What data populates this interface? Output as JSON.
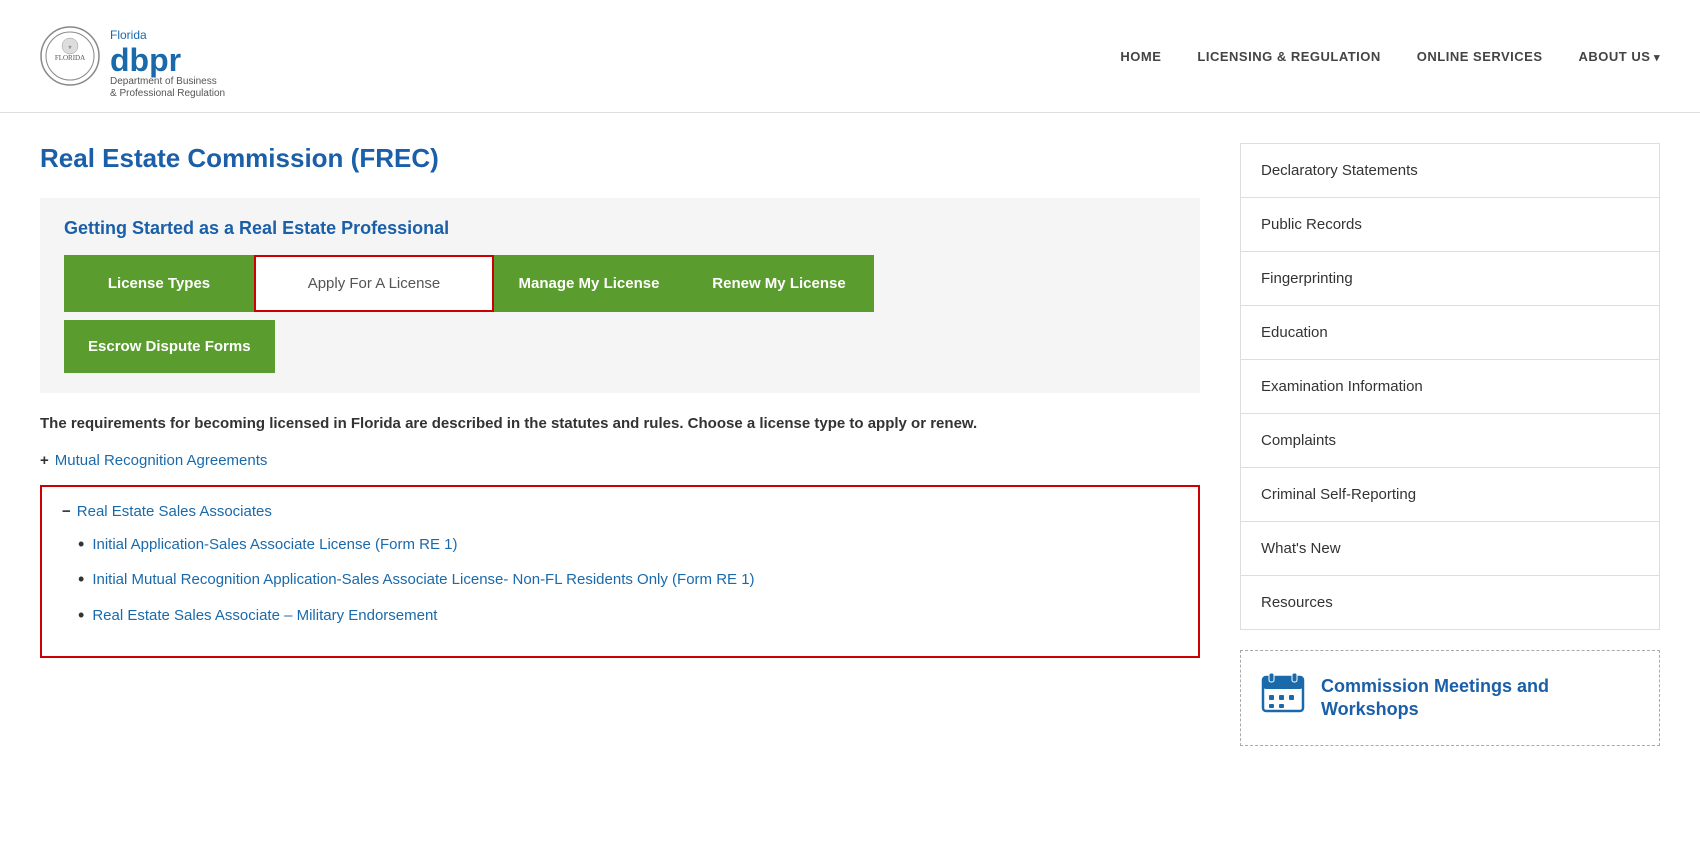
{
  "header": {
    "logo_dbpr": "dbpr",
    "logo_florida": "Florida",
    "logo_subtitle": "Department of Business\n& Professional Regulation",
    "nav": [
      {
        "label": "HOME",
        "has_arrow": false
      },
      {
        "label": "LICENSING & REGULATION",
        "has_arrow": false
      },
      {
        "label": "ONLINE SERVICES",
        "has_arrow": false
      },
      {
        "label": "ABOUT US",
        "has_arrow": true
      }
    ]
  },
  "main": {
    "page_title": "Real Estate Commission (FREC)",
    "getting_started": {
      "title": "Getting Started as a Real Estate Professional",
      "buttons": [
        {
          "label": "License Types",
          "style": "green"
        },
        {
          "label": "Apply For A License",
          "style": "outlined"
        },
        {
          "label": "Manage My License",
          "style": "green"
        },
        {
          "label": "Renew My License",
          "style": "green"
        }
      ],
      "buttons_row2": [
        {
          "label": "Escrow Dispute Forms",
          "style": "green"
        }
      ]
    },
    "description": "The requirements for becoming licensed in Florida are described in the statutes and rules.  Choose a license type to apply or renew.",
    "accordion_label": "Mutual Recognition Agreements",
    "red_section": {
      "header_label": "Real Estate Sales Associates",
      "items": [
        "Initial Application-Sales Associate License (Form RE 1)",
        "Initial Mutual Recognition Application-Sales Associate License- Non-FL Residents Only (Form RE 1)",
        "Real Estate Sales Associate – Military Endorsement"
      ]
    }
  },
  "sidebar": {
    "menu_items": [
      "Declaratory Statements",
      "Public Records",
      "Fingerprinting",
      "Education",
      "Examination Information",
      "Complaints",
      "Criminal Self-Reporting",
      "What's New",
      "Resources"
    ],
    "commission_box": {
      "title": "Commission Meetings and Workshops"
    }
  }
}
